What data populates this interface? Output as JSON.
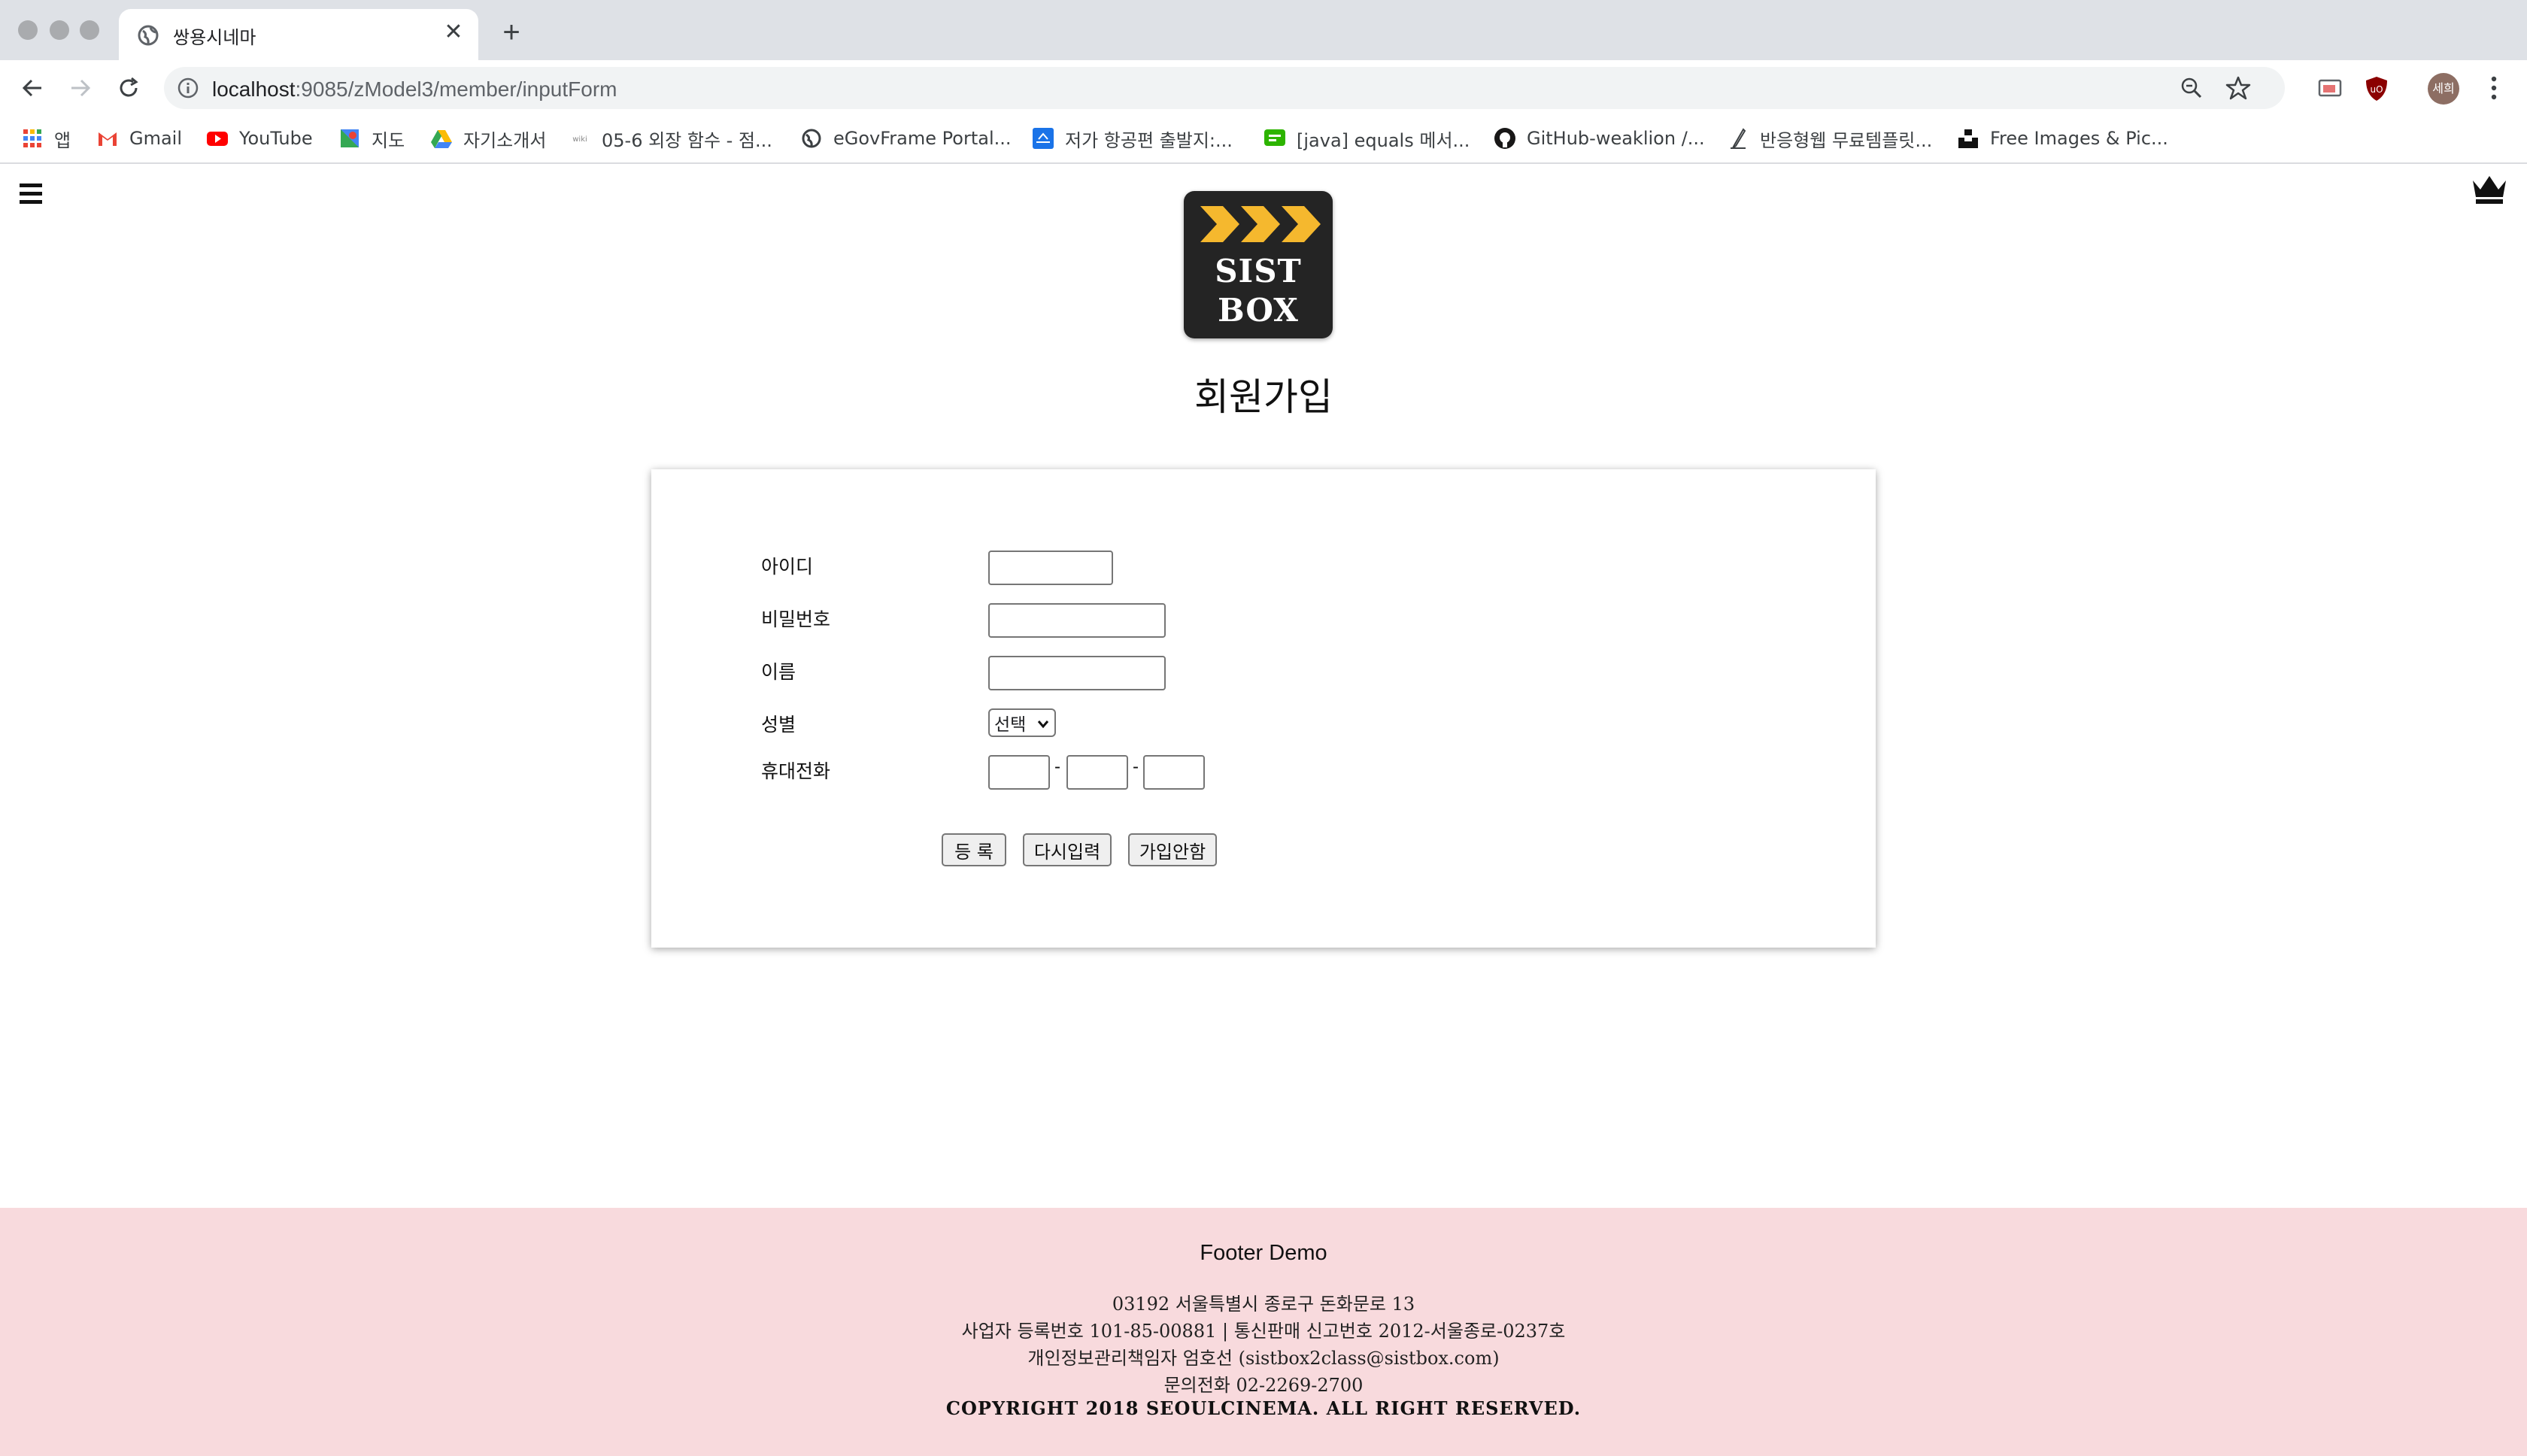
{
  "browser": {
    "tab_title": "쌍용시네마",
    "url_host": "localhost",
    "url_rest": ":9085/zModel3/member/inputForm",
    "profile_initials": "세희",
    "bookmarks": [
      {
        "label": "앱",
        "icon": "apps-grid-icon"
      },
      {
        "label": "Gmail",
        "icon": "gmail-icon"
      },
      {
        "label": "YouTube",
        "icon": "youtube-icon"
      },
      {
        "label": "지도",
        "icon": "maps-icon"
      },
      {
        "label": "자기소개서",
        "icon": "drive-icon"
      },
      {
        "label": "05-6 외장 함수 - 점...",
        "icon": "wikidocs-icon"
      },
      {
        "label": "eGovFrame Portal...",
        "icon": "globe-icon"
      },
      {
        "label": "저가 항공편 출발지:...",
        "icon": "flight-icon"
      },
      {
        "label": "[java] equals 메서...",
        "icon": "note-icon"
      },
      {
        "label": "GitHub-weaklion /...",
        "icon": "github-icon"
      },
      {
        "label": "반응형웹 무료템플릿...",
        "icon": "pen-icon"
      },
      {
        "label": "Free Images & Pic...",
        "icon": "unsplash-icon"
      }
    ]
  },
  "page": {
    "logo_line1": "SIST",
    "logo_line2": "BOX",
    "title": "회원가입",
    "form": {
      "id_label": "아이디",
      "password_label": "비밀번호",
      "name_label": "이름",
      "gender_label": "성별",
      "gender_selected": "선택",
      "phone_label": "휴대전화",
      "phone_separator": "-",
      "register_button": "등 록",
      "reset_button": "다시입력",
      "cancel_button": "가입안함"
    }
  },
  "footer": {
    "title": "Footer Demo",
    "address": "03192 서울특별시 종로구 돈화문로 13",
    "business": "사업자 등록번호 101-85-00881 | 통신판매 신고번호 2012-서울종로-0237호",
    "privacy": "개인정보관리책임자 엄호선 (sistbox2class@sistbox.com)",
    "phone": "문의전화 02-2269-2700",
    "copyright": "COPYRIGHT 2018 SEOULCINEMA. ALL RIGHT RESERVED."
  },
  "colors": {
    "footer_bg": "#f8dadd",
    "logo_bg": "#242424",
    "logo_chevron": "#f5b82e"
  }
}
